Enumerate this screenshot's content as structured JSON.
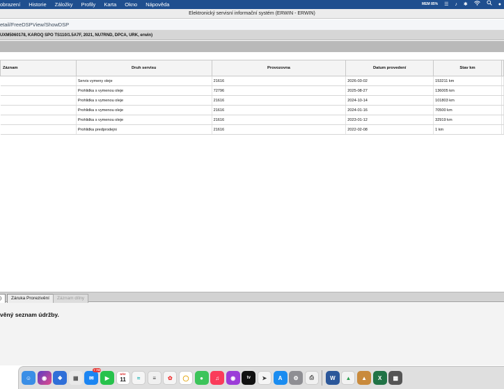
{
  "menubar": {
    "items": [
      "obrazení",
      "Historie",
      "Záložky",
      "Profily",
      "Karta",
      "Okno",
      "Nápověda"
    ],
    "status_icons": [
      "memory-icon",
      "control-center-icon",
      "mute-icon",
      "bluetooth-icon",
      "wifi-icon",
      "search-icon",
      "user-icon"
    ],
    "memory": {
      "top": "MEM",
      "value": "85%"
    }
  },
  "window": {
    "title": "Elektronický servisní informační systém (ERWIN - ERWIN)"
  },
  "urlbar": {
    "path": "etail/FreeDSPView/ShowDSP"
  },
  "vehicle": {
    "info": "UXM5060178, KAROQ SPO TS110/1.5A7F, 2021, NU7RND, DPCA, URK, erwin)"
  },
  "table": {
    "headers": [
      "Záznam",
      "Druh servisu",
      "Provozovna",
      "Datum provedení",
      "Stav km",
      ""
    ],
    "rows": [
      [
        "",
        "Servis vymeny oleje",
        "21616",
        "2026-03-02",
        "153211 km"
      ],
      [
        "",
        "Prohlidka s vymenou oleje",
        "72796",
        "2025-08-27",
        "136005 km"
      ],
      [
        "",
        "Prohlidka s vymenou oleje",
        "21616",
        "2024-10-14",
        "101803 km"
      ],
      [
        "",
        "Prohlidka s vymenou oleje",
        "21616",
        "2024-01-16",
        "70500 km"
      ],
      [
        "",
        "Prohlidka s vymenou oleje",
        "21616",
        "2023-01-12",
        "32919 km"
      ],
      [
        "",
        "Prohlidka predprodejni",
        "21616",
        "2022-02-08",
        "1 km"
      ]
    ]
  },
  "tabs": [
    {
      "label": ")",
      "state": "active"
    },
    {
      "label": "Záruka Prorezivění",
      "state": "normal"
    },
    {
      "label": "Záznam dílny",
      "state": "disabled"
    }
  ],
  "message": "věný seznam údržby.",
  "dock": {
    "calendar_month": "BŘE",
    "calendar_day": "11",
    "mail_badge": "7 705",
    "word_label": "W",
    "excel_label": "X"
  }
}
